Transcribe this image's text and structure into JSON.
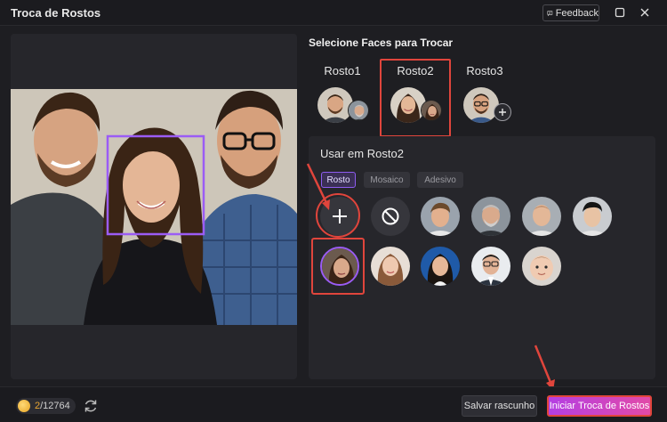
{
  "window": {
    "title": "Troca de Rostos",
    "feedback_label": "Feedback"
  },
  "preview": {
    "people": 3,
    "selected_face": "middle"
  },
  "right": {
    "heading": "Selecione Faces para Trocar",
    "slots": [
      {
        "label": "Rosto1",
        "selected": false
      },
      {
        "label": "Rosto2",
        "selected": true
      },
      {
        "label": "Rosto3",
        "selected": false
      }
    ]
  },
  "panel": {
    "title": "Usar em Rosto2",
    "tabs": [
      {
        "label": "Rosto",
        "active": true
      },
      {
        "label": "Mosaico",
        "active": false
      },
      {
        "label": "Adesivo",
        "active": false
      }
    ],
    "library_rows": 2
  },
  "footer": {
    "credits_used": "2",
    "credits_total": "/12764",
    "save_label": "Salvar rascunho",
    "start_label": "Iniciar Troca de Rostos"
  },
  "colors": {
    "accent": "#8e5cf0",
    "highlight": "#e0453c",
    "start_gradient": [
      "#b43fe3",
      "#e24aa8"
    ]
  }
}
